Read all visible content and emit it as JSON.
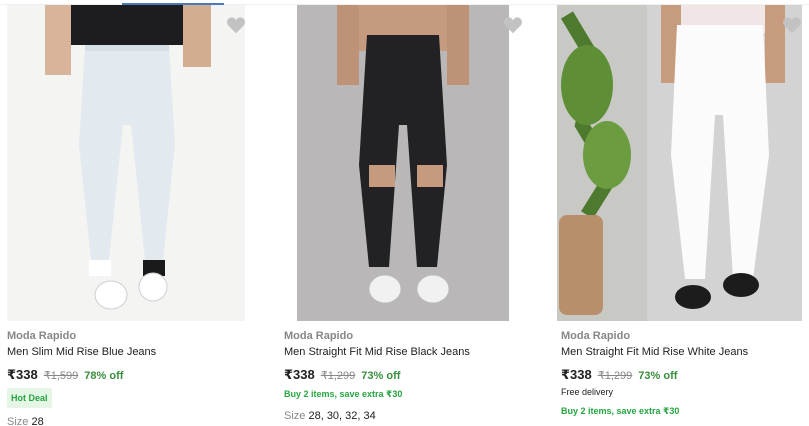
{
  "colors": {
    "discount": "#388e3c",
    "offer": "#26a541",
    "muted": "#878787"
  },
  "products": [
    {
      "brand": "Moda Rapido",
      "title": "Men Slim Mid Rise Blue Jeans",
      "price": "₹338",
      "mrp": "₹1,599",
      "discount": "78% off",
      "badge": "Hot Deal",
      "size_label": "Size",
      "sizes": "28",
      "wishlist_icon": "heart-icon"
    },
    {
      "brand": "Moda Rapido",
      "title": "Men Straight Fit Mid Rise Black Jeans",
      "price": "₹338",
      "mrp": "₹1,299",
      "discount": "73% off",
      "offer": "Buy 2 items, save extra ₹30",
      "size_label": "Size",
      "sizes": "28, 30, 32, 34",
      "wishlist_icon": "heart-icon"
    },
    {
      "brand": "Moda Rapido",
      "title": "Men Straight Fit Mid Rise White Jeans",
      "price": "₹338",
      "mrp": "₹1,299",
      "discount": "73% off",
      "delivery": "Free delivery",
      "offer": "Buy 2 items, save extra ₹30",
      "wishlist_icon": "heart-icon"
    }
  ]
}
